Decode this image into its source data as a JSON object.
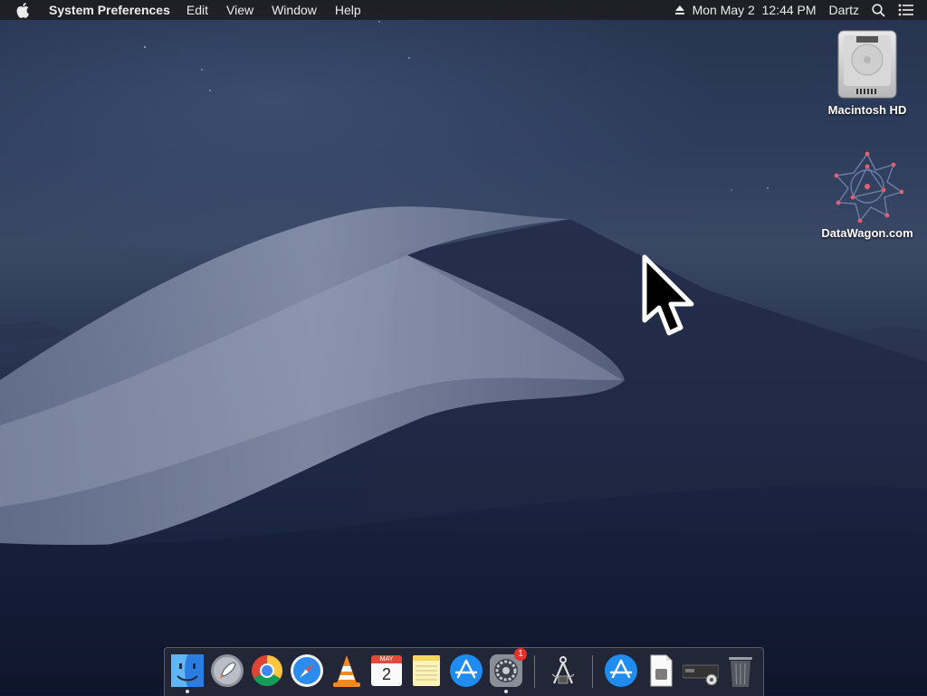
{
  "menubar": {
    "app_name": "System Preferences",
    "menus": [
      "Edit",
      "View",
      "Window",
      "Help"
    ],
    "clock": "Mon May 2  12:44 PM",
    "user": "Dartz"
  },
  "desktop": {
    "icons": [
      {
        "label": "Macintosh HD",
        "icon": "hard-drive-icon"
      },
      {
        "label": "DataWagon.com",
        "icon": "network-star-icon"
      }
    ]
  },
  "dock": {
    "apps": [
      {
        "name": "finder",
        "icon": "finder-icon",
        "running": true
      },
      {
        "name": "launchpad",
        "icon": "rocket-icon",
        "running": false
      },
      {
        "name": "chrome",
        "icon": "chrome-icon",
        "running": false
      },
      {
        "name": "safari",
        "icon": "compass-icon",
        "running": false
      },
      {
        "name": "vlc",
        "icon": "traffic-cone-icon",
        "running": false
      },
      {
        "name": "calendar",
        "icon": "calendar-icon",
        "running": false,
        "month": "MAY",
        "day": "2"
      },
      {
        "name": "notes",
        "icon": "notes-icon",
        "running": false
      },
      {
        "name": "app-store",
        "icon": "app-store-icon",
        "running": false
      },
      {
        "name": "system-preferences",
        "icon": "gear-icon",
        "running": true,
        "badge": "1"
      },
      {
        "name": "utility",
        "icon": "compass-tool-icon",
        "running": false
      },
      {
        "name": "app-store-download",
        "icon": "app-store-icon",
        "running": false
      },
      {
        "name": "document",
        "icon": "document-icon",
        "running": false
      },
      {
        "name": "device",
        "icon": "device-icon",
        "running": false
      },
      {
        "name": "trash",
        "icon": "trash-icon",
        "running": false
      }
    ]
  },
  "colors": {
    "menubar_bg": "#1e1e22",
    "badge": "#e8302a",
    "wallpaper_sky": "#2e3d5c",
    "wallpaper_dune": "#1f2a47"
  }
}
